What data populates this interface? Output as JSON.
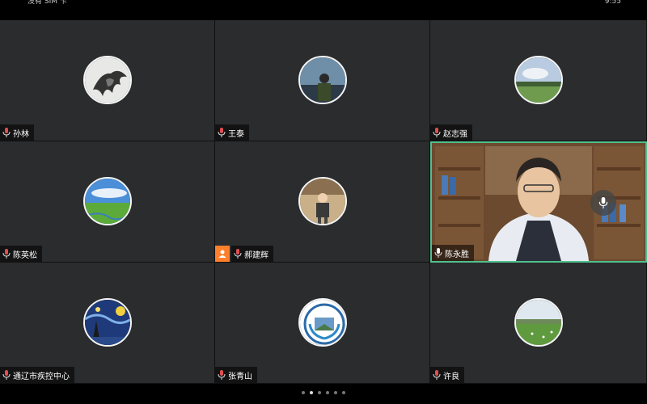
{
  "status_bar": {
    "left_text": "没有 SIM 卡",
    "time": "9:55"
  },
  "participants": [
    {
      "name": "孙林"
    },
    {
      "name": "王泰"
    },
    {
      "name": "赵志强"
    },
    {
      "name": "陈英松"
    },
    {
      "name": "郝建辉"
    },
    {
      "name": "陈永胜",
      "video_on": true
    },
    {
      "name": "通辽市疾控中心"
    },
    {
      "name": "张青山"
    },
    {
      "name": "许良"
    }
  ],
  "pager": {
    "total": 6,
    "active": 2
  },
  "colors": {
    "tile_bg": "#2b2c2e",
    "active_border": "#4fc08d",
    "host_badge": "#ff7f2a",
    "mic": "#e05050"
  }
}
